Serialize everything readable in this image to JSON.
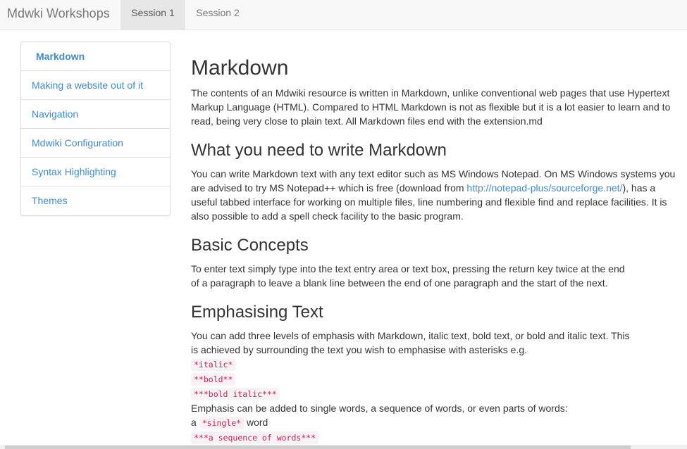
{
  "navbar": {
    "brand": "Mdwki Workshops",
    "tabs": [
      {
        "label": "Session 1",
        "active": true
      },
      {
        "label": "Session 2",
        "active": false
      }
    ]
  },
  "sidebar": {
    "items": [
      {
        "label": "Markdown",
        "active": true
      },
      {
        "label": "Making a website out of it"
      },
      {
        "label": "Navigation"
      },
      {
        "label": "Mdwiki Configuration"
      },
      {
        "label": "Syntax Highlighting"
      },
      {
        "label": "Themes"
      }
    ]
  },
  "content": {
    "title": "Markdown",
    "intro": "The contents of an Mdwiki resource is written in Markdown, unlike conventional web pages that use Hypertext Markup Language (HTML). Compared to HTML Markdown is not as flexible but it is a lot easier to learn and to read, being very close to plain text. All Markdown files end with the extension.md",
    "section1": {
      "heading": "What you need to write Markdown",
      "text_before_link": "You can write Markdown text with any text editor such as MS Windows Notepad. On MS Windows systems you are advised to try MS Notepad++ which is free (download from ",
      "link": "http://notepad-plus/sourceforge.net/",
      "text_after_link": "), has a useful tabbed interface for working on multiple files, line numbering and flexible find and replace facilities. It is also possible to add a spell check facility to the basic program."
    },
    "section2": {
      "heading": "Basic Concepts",
      "text": "To enter text simply type into the text entry area or text box, pressing the return key twice at the end of a paragraph to leave a blank line between the end of one paragraph and the start of the next."
    },
    "section3": {
      "heading": "Emphasising Text",
      "text": "You can add three levels of emphasis with Markdown, italic text, bold text, or bold and italic text. This is achieved by surrounding the text you wish to emphasise with asterisks e.g.",
      "examples": [
        "*italic*",
        "**bold**",
        "***bold italic***"
      ],
      "text2": "Emphasis can be added to single words, a sequence of words, or even parts of words:",
      "single_prefix": "a",
      "single_code": "*single*",
      "single_suffix": "word",
      "sequence_code": "***a sequence of words***"
    }
  }
}
